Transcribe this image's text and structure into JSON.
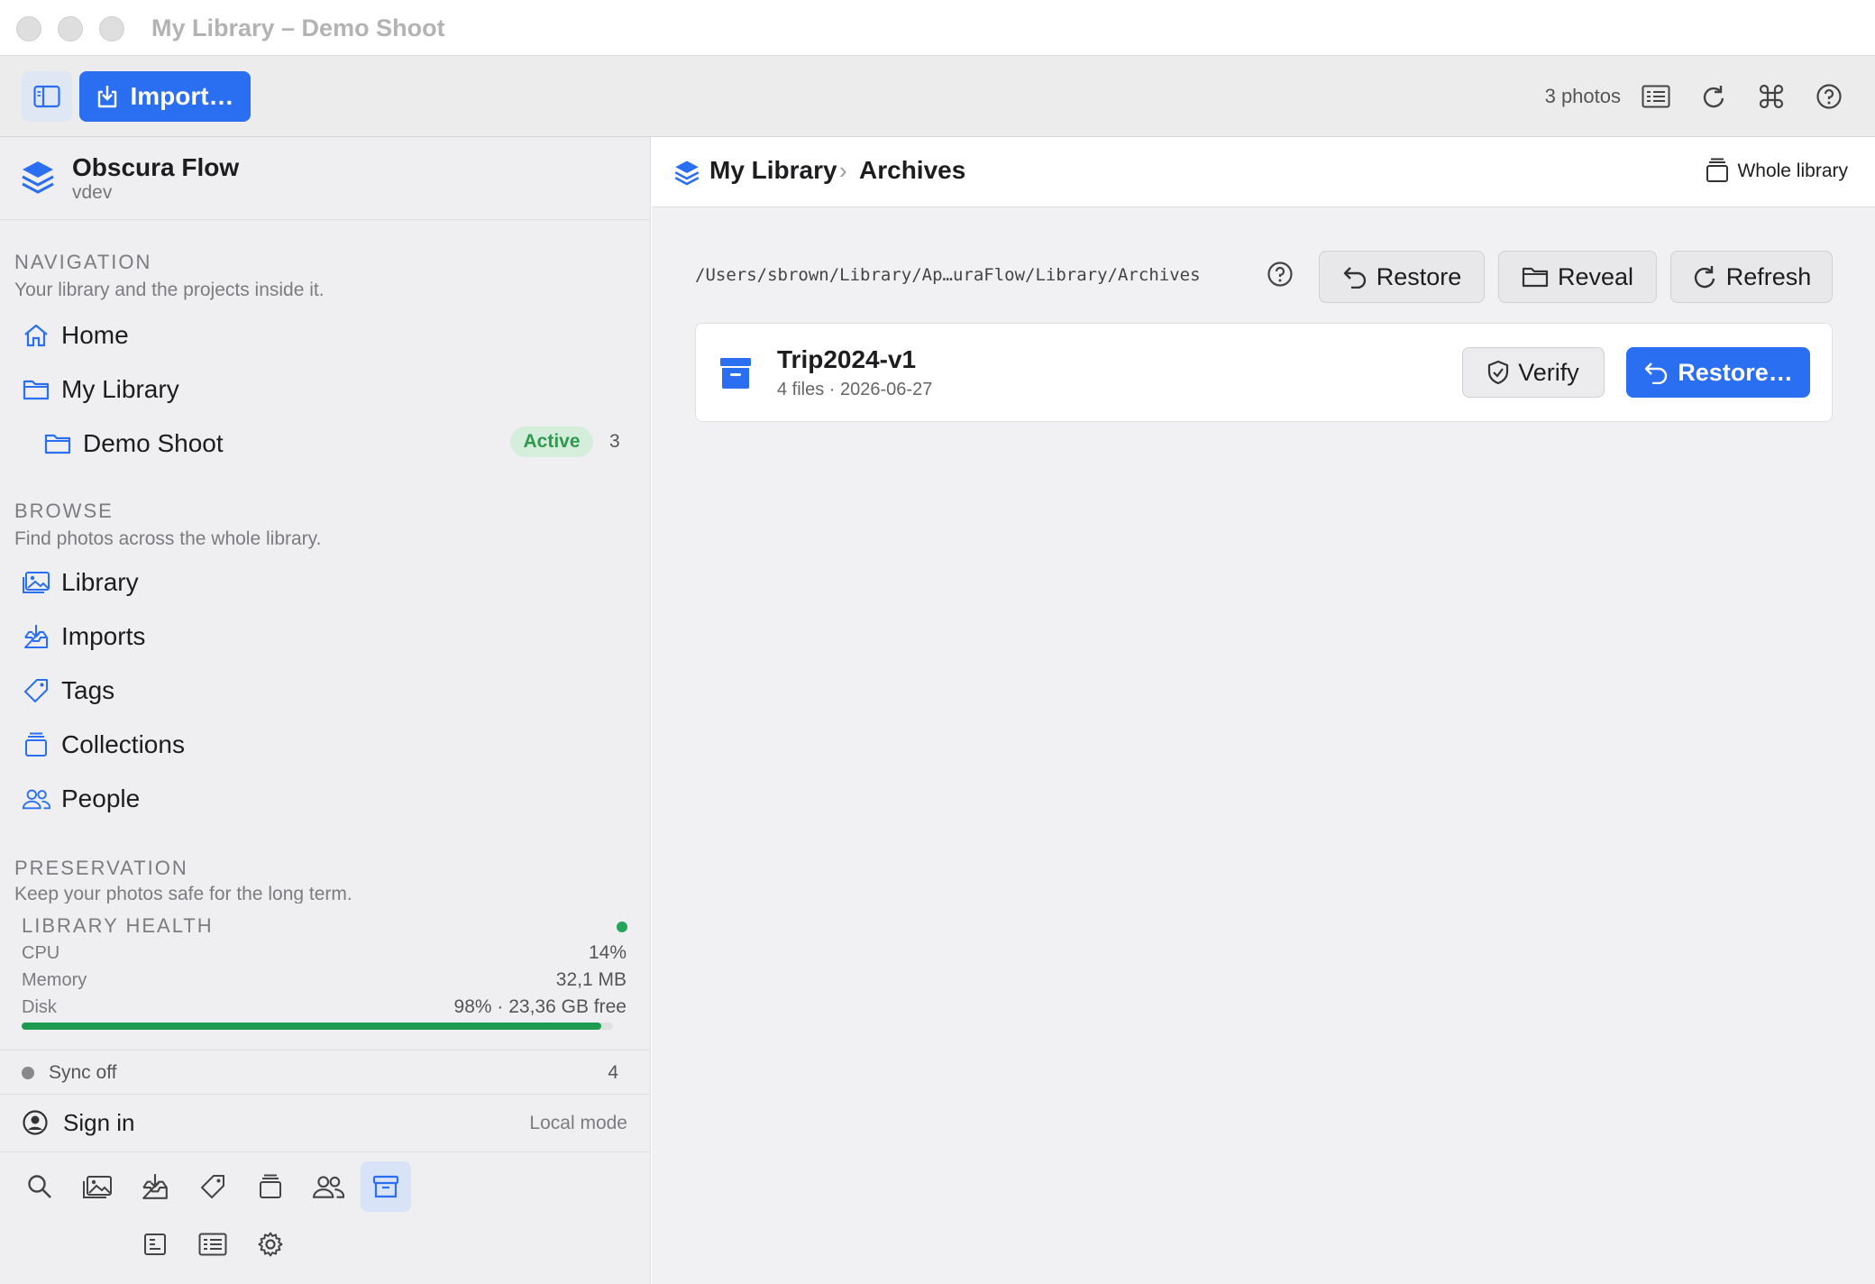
{
  "window": {
    "title": "My Library – Demo Shoot"
  },
  "toolbar": {
    "import_label": "Import…",
    "photo_count": "3 photos"
  },
  "app": {
    "name": "Obscura Flow",
    "version": "vdev"
  },
  "navigation": {
    "title": "NAVIGATION",
    "subtitle": "Your library and the projects inside it.",
    "items": [
      {
        "label": "Home",
        "icon": "home-icon"
      },
      {
        "label": "My Library",
        "icon": "folder-icon"
      },
      {
        "label": "Demo Shoot",
        "icon": "folder-icon",
        "badge": "Active",
        "count": "3"
      }
    ]
  },
  "browse": {
    "title": "BROWSE",
    "subtitle": "Find photos across the whole library.",
    "items": [
      {
        "label": "Library",
        "icon": "photos-icon"
      },
      {
        "label": "Imports",
        "icon": "import-tray-icon"
      },
      {
        "label": "Tags",
        "icon": "tag-icon"
      },
      {
        "label": "Collections",
        "icon": "collections-icon"
      },
      {
        "label": "People",
        "icon": "people-icon"
      }
    ]
  },
  "preservation": {
    "title": "PRESERVATION",
    "subtitle": "Keep your photos safe for the long term."
  },
  "health": {
    "title": "LIBRARY HEALTH",
    "cpu_label": "CPU",
    "cpu_value": "14%",
    "memory_label": "Memory",
    "memory_value": "32,1 MB",
    "disk_label": "Disk",
    "disk_value": "98% · 23,36 GB free",
    "disk_fraction": 0.98,
    "status_color": "#23a55a"
  },
  "sync": {
    "label": "Sync off",
    "count": "4"
  },
  "account": {
    "signin_label": "Sign in",
    "mode": "Local mode"
  },
  "breadcrumb": {
    "library": "My Library",
    "separator": "›",
    "current": "Archives",
    "scope": "Whole library"
  },
  "archives": {
    "path": "/Users/sbrown/Library/Ap…uraFlow/Library/Archives",
    "restore_label": "Restore",
    "reveal_label": "Reveal",
    "refresh_label": "Refresh",
    "items": [
      {
        "name": "Trip2024-v1",
        "meta": "4 files · 2026-06-27",
        "verify_label": "Verify",
        "restore_label": "Restore…"
      }
    ]
  },
  "colors": {
    "accent": "#2a6ef2",
    "active_badge_bg": "#d5eedb",
    "active_badge_text": "#2f9a4f"
  }
}
